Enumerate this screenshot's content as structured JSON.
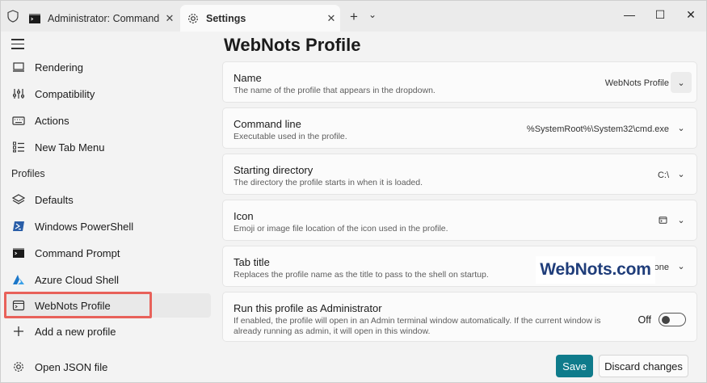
{
  "titlebar": {
    "tabs": [
      {
        "title": "Administrator: Command Pr",
        "close": "✕",
        "icon": "terminal-icon"
      },
      {
        "title": "Settings",
        "close": "✕",
        "icon": "gear-icon"
      }
    ],
    "new_tab": "+",
    "tab_dropdown": "⌄",
    "minimize": "—",
    "maximize": "☐",
    "close": "✕"
  },
  "sidebar": {
    "items_top": [
      {
        "label": "Rendering",
        "icon": "monitor-icon"
      },
      {
        "label": "Compatibility",
        "icon": "compatibility-icon"
      },
      {
        "label": "Actions",
        "icon": "keyboard-icon"
      },
      {
        "label": "New Tab Menu",
        "icon": "list-icon"
      }
    ],
    "section_label": "Profiles",
    "profiles": [
      {
        "label": "Defaults",
        "icon": "layers-icon"
      },
      {
        "label": "Windows PowerShell",
        "icon": "powershell-icon"
      },
      {
        "label": "Command Prompt",
        "icon": "cmd-icon"
      },
      {
        "label": "Azure Cloud Shell",
        "icon": "azure-icon"
      },
      {
        "label": "WebNots Profile",
        "icon": "profile-icon"
      }
    ],
    "add_profile": {
      "label": "Add a new profile",
      "icon": "plus-icon"
    },
    "open_json": {
      "label": "Open JSON file",
      "icon": "gear-icon"
    }
  },
  "main": {
    "title": "WebNots Profile",
    "settings": [
      {
        "label": "Name",
        "desc": "The name of the profile that appears in the dropdown.",
        "value": "WebNots Profile"
      },
      {
        "label": "Command line",
        "desc": "Executable used in the profile.",
        "value": "%SystemRoot%\\System32\\cmd.exe"
      },
      {
        "label": "Starting directory",
        "desc": "The directory the profile starts in when it is loaded.",
        "value": "C:\\"
      },
      {
        "label": "Icon",
        "desc": "Emoji or image file location of the icon used in the profile.",
        "value": ""
      },
      {
        "label": "Tab title",
        "desc": "Replaces the profile name as the title to pass to the shell on startup.",
        "value": "None"
      },
      {
        "label": "Run this profile as Administrator",
        "desc": "If enabled, the profile will open in an Admin terminal window automatically. If the current window is already running as admin, it will open in this window.",
        "value": "Off"
      }
    ],
    "chevron": "⌄"
  },
  "footer": {
    "save": "Save",
    "discard": "Discard changes"
  },
  "watermark": "WebNots.com",
  "colors": {
    "accent": "#0f7b8b",
    "highlight": "#e8615a",
    "watermark": "#1f3d7a"
  }
}
